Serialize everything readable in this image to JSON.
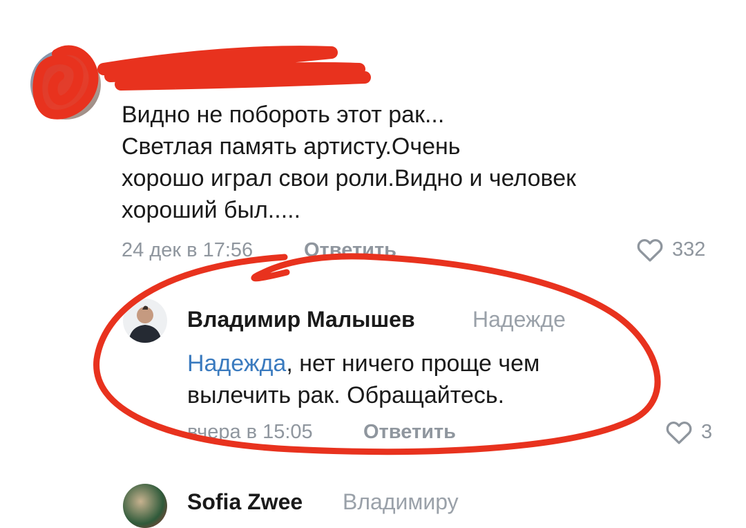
{
  "comments": [
    {
      "author": "",
      "text_lines": [
        "Видно не побороть этот рак...",
        "Светлая память артисту.Очень",
        "хорошо играл свои роли.Видно и человек",
        "хороший был....."
      ],
      "timestamp": "24 дек в 17:56",
      "reply_label": "Ответить",
      "likes": "332"
    },
    {
      "author": "Владимир Малышев",
      "reply_to": "Надежде",
      "mention": "Надежда",
      "text_after_mention": ", нет ничего проще чем",
      "text_line2": "вылечить рак. Обращайтесь.",
      "timestamp": "вчера в 15:05",
      "reply_label": "Ответить",
      "likes": "3"
    },
    {
      "author": "Sofia Zwee",
      "reply_to": "Владимиру"
    }
  ],
  "colors": {
    "annotation_red": "#e8321e",
    "mention_blue": "#3b7bbf",
    "meta_gray": "#8f969e"
  },
  "icons": [
    "heart-outline-icon",
    "avatar"
  ]
}
